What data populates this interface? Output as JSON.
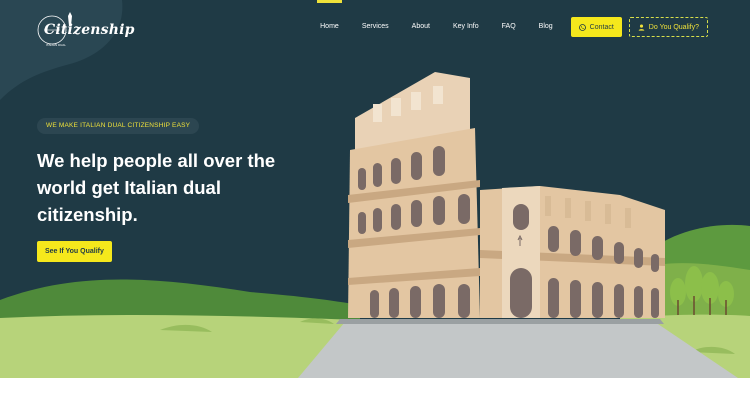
{
  "logo": {
    "text": "Citizenship",
    "icon": "tower-logo-icon"
  },
  "nav": {
    "links": [
      "Home",
      "Services",
      "About",
      "Key Info",
      "FAQ",
      "Blog"
    ],
    "contact_label": "Contact",
    "contact_icon": "phone-icon",
    "qualify_label": "Do You Qualify?",
    "qualify_icon": "user-icon"
  },
  "hero": {
    "eyebrow": "WE MAKE ITALIAN DUAL CITIZENSHIP EASY",
    "headline": "We help people all over the world get Italian dual citizenship.",
    "cta_label": "See If You Qualify"
  },
  "colors": {
    "navy": "#1f3a45",
    "accent": "#f5e81c",
    "grass": "#b7d37a",
    "white": "#ffffff"
  }
}
